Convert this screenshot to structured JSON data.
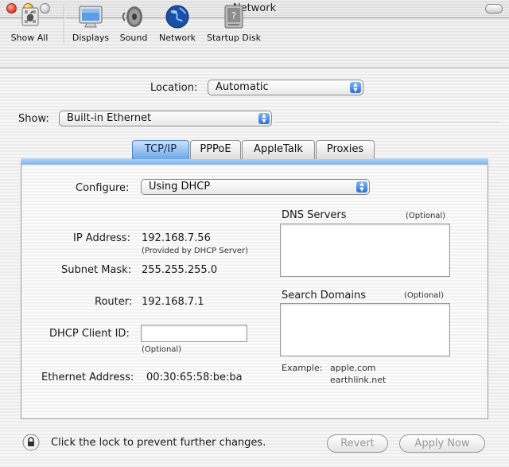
{
  "window": {
    "title": "Network"
  },
  "toolbar": {
    "items": [
      {
        "label": "Show All",
        "icon": "show-all-icon"
      },
      {
        "label": "Displays",
        "icon": "display-icon"
      },
      {
        "label": "Sound",
        "icon": "speaker-icon"
      },
      {
        "label": "Network",
        "icon": "globe-icon"
      },
      {
        "label": "Startup Disk",
        "icon": "disk-icon"
      }
    ]
  },
  "location": {
    "label": "Location:",
    "value": "Automatic"
  },
  "show": {
    "label": "Show:",
    "value": "Built-in Ethernet"
  },
  "tabs": [
    {
      "label": "TCP/IP",
      "active": true
    },
    {
      "label": "PPPoE",
      "active": false
    },
    {
      "label": "AppleTalk",
      "active": false
    },
    {
      "label": "Proxies",
      "active": false
    }
  ],
  "tcpip": {
    "configure_label": "Configure:",
    "configure_value": "Using DHCP",
    "ip_label": "IP Address:",
    "ip_value": "192.168.7.56",
    "ip_note": "(Provided by DHCP Server)",
    "subnet_label": "Subnet Mask:",
    "subnet_value": "255.255.255.0",
    "router_label": "Router:",
    "router_value": "192.168.7.1",
    "dhcp_label": "DHCP Client ID:",
    "dhcp_value": "",
    "dhcp_note": "(Optional)",
    "ethernet_label": "Ethernet Address:",
    "ethernet_value": "00:30:65:58:be:ba",
    "dns_label": "DNS Servers",
    "dns_optional": "(Optional)",
    "dns_value": "",
    "search_label": "Search Domains",
    "search_optional": "(Optional)",
    "search_value": "",
    "example_label": "Example:",
    "example_line1": "apple.com",
    "example_line2": "earthlink.net"
  },
  "footer": {
    "lock_text": "Click the lock to prevent further changes.",
    "revert_label": "Revert",
    "apply_label": "Apply Now"
  },
  "colors": {
    "accent": "#3b7fd9",
    "tab_active": "#6aa6ea",
    "disabled_text": "#9a9a9a"
  }
}
